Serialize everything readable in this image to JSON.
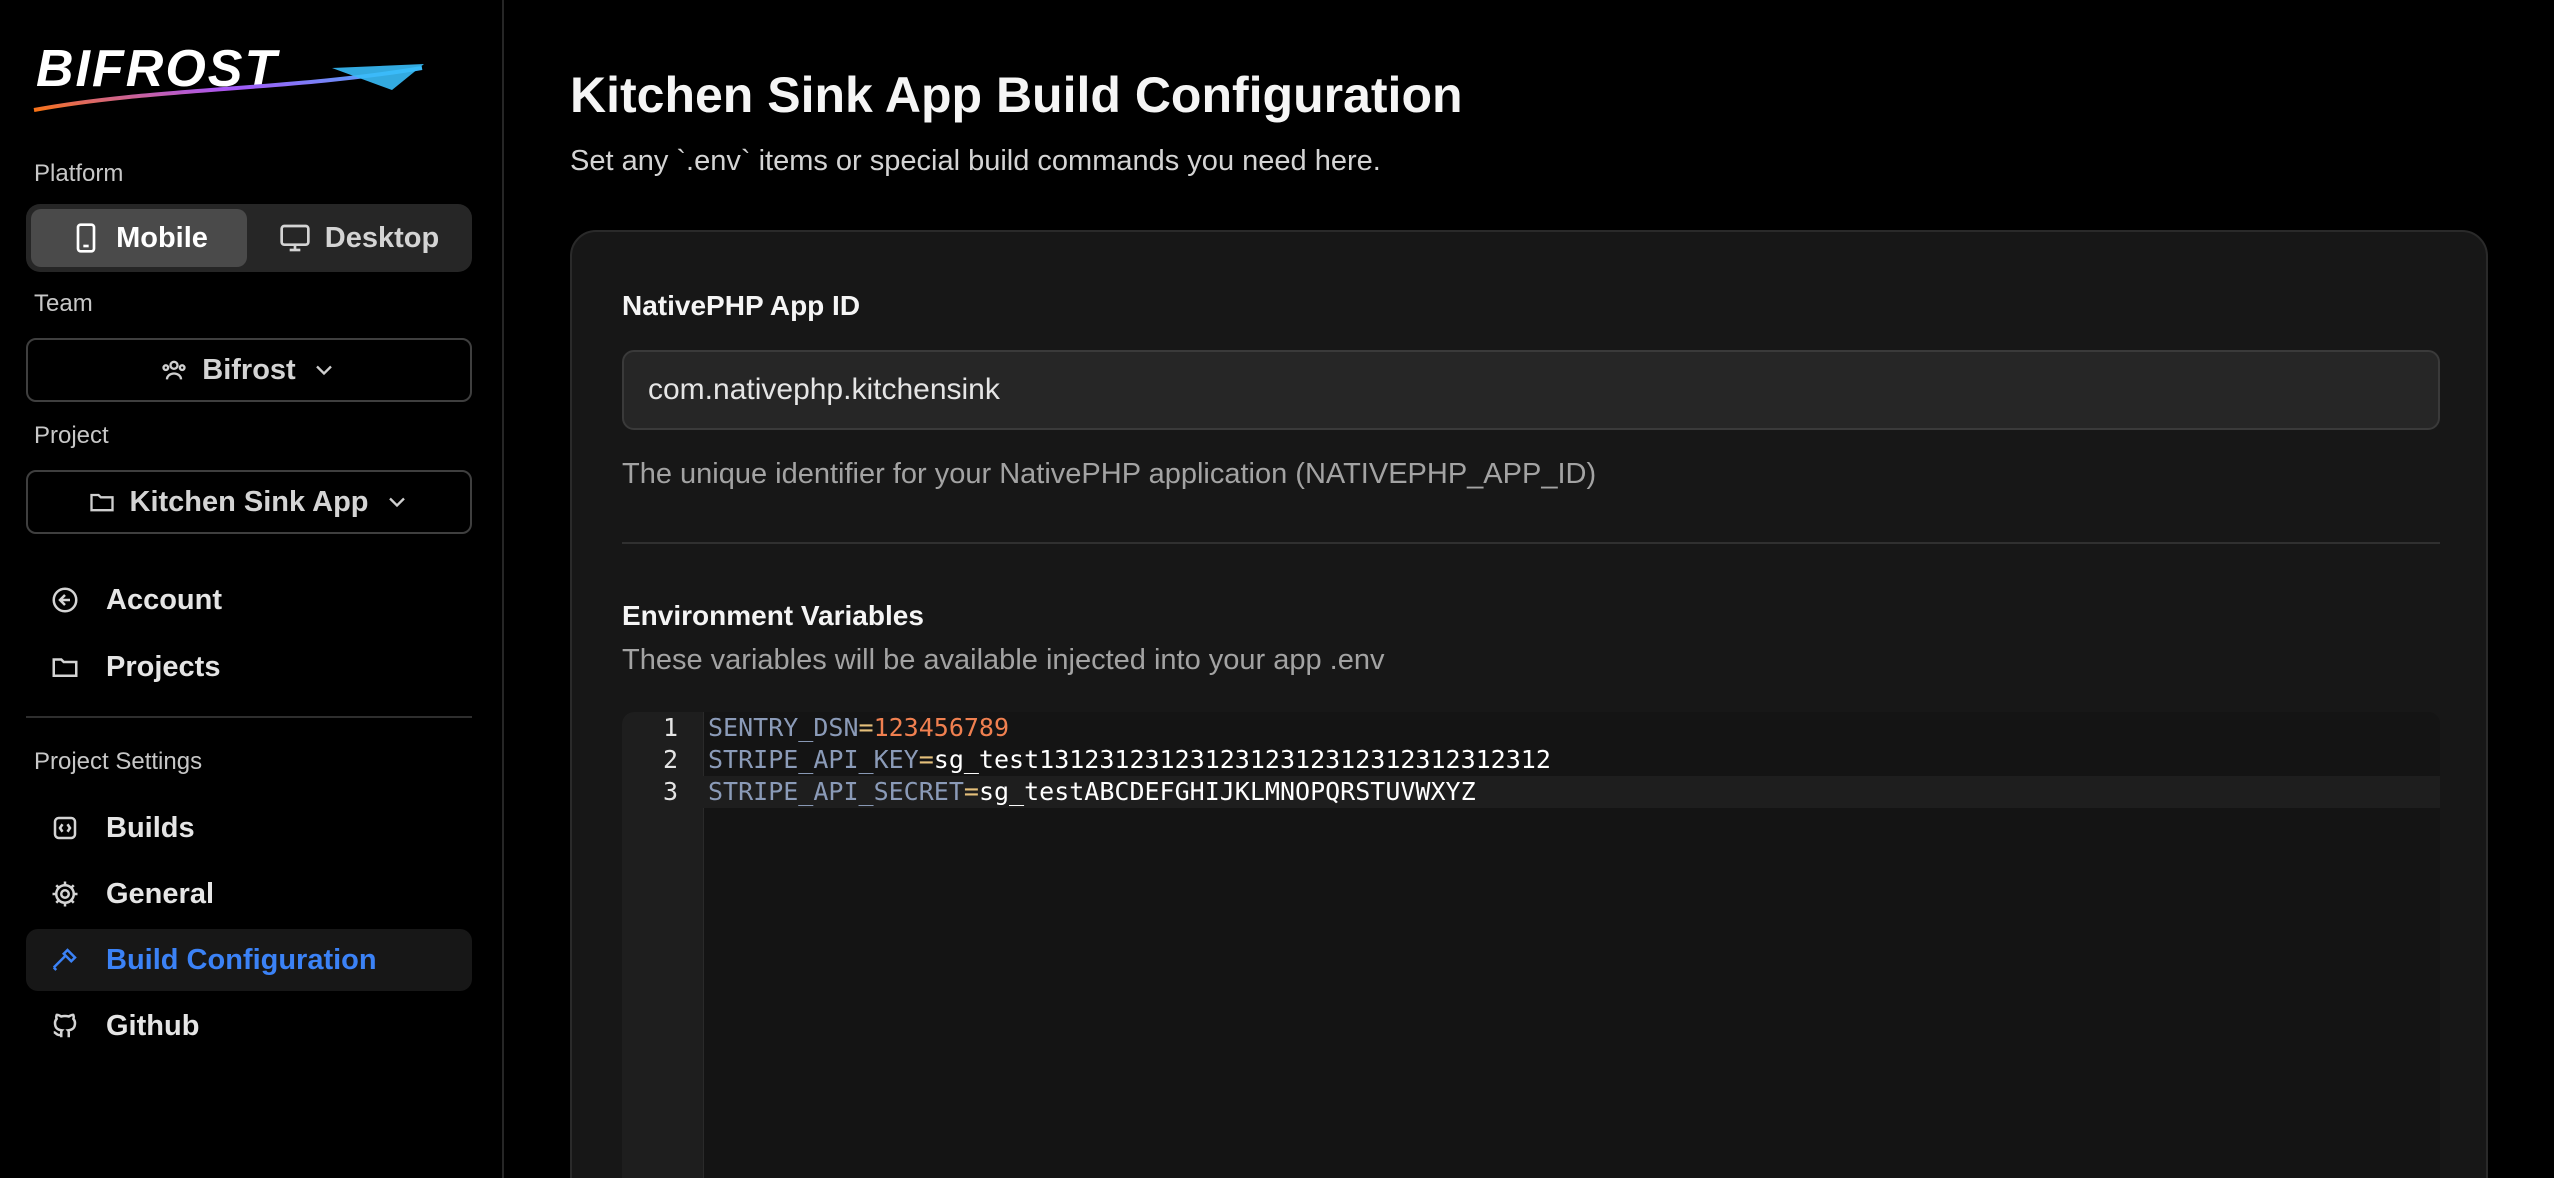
{
  "sidebar": {
    "logo_text": "BIFROST",
    "platform_label": "Platform",
    "platform_options": [
      "Mobile",
      "Desktop"
    ],
    "team_label": "Team",
    "team_value": "Bifrost",
    "project_label": "Project",
    "project_value": "Kitchen Sink App",
    "nav": [
      {
        "label": "Account",
        "icon": "arrow-left-circle-icon"
      },
      {
        "label": "Projects",
        "icon": "folder-icon"
      }
    ],
    "settings_label": "Project Settings",
    "settings_nav": [
      {
        "label": "Builds",
        "icon": "code-file-icon"
      },
      {
        "label": "General",
        "icon": "gear-icon"
      },
      {
        "label": "Build Configuration",
        "icon": "hammer-icon"
      },
      {
        "label": "Github",
        "icon": "github-icon"
      }
    ],
    "accent_color": "#3b82f6"
  },
  "main": {
    "title": "Kitchen Sink App Build Configuration",
    "subtitle": "Set any `.env` items or special build commands you need here.",
    "app_id": {
      "label": "NativePHP App ID",
      "value": "com.nativephp.kitchensink",
      "help": "The unique identifier for your NativePHP application (NATIVEPHP_APP_ID)"
    },
    "env": {
      "label": "Environment Variables",
      "help": "These variables will be available injected into your app .env",
      "lines": [
        {
          "num": "1",
          "key": "SENTRY_DSN",
          "eq": "=",
          "value": "123456789"
        },
        {
          "num": "2",
          "key": "STRIPE_API_KEY",
          "eq": "=",
          "value": "sg_test1312312312312312312312312312312312"
        },
        {
          "num": "3",
          "key": "STRIPE_API_SECRET",
          "eq": "=",
          "value": "sg_testABCDEFGHIJKLMNOPQRSTUVWXYZ"
        }
      ]
    }
  }
}
